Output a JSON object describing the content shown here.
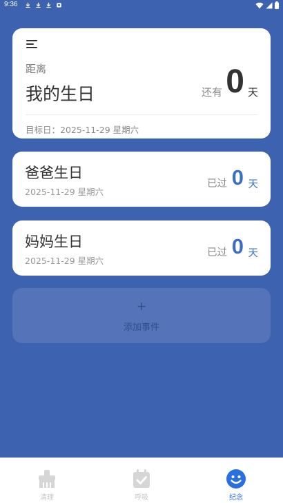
{
  "status_bar": {
    "time": "9:36"
  },
  "main_card": {
    "label": "距离",
    "title": "我的生日",
    "prefix": "还有",
    "days": "0",
    "unit": "天",
    "target_date": "目标日：2025-11-29 星期六"
  },
  "events": [
    {
      "title": "爸爸生日",
      "date": "2025-11-29 星期六",
      "prefix": "已过",
      "days": "0",
      "unit": "天"
    },
    {
      "title": "妈妈生日",
      "date": "2025-11-29 星期六",
      "prefix": "已过",
      "days": "0",
      "unit": "天"
    }
  ],
  "add_event": {
    "plus": "+",
    "label": "添加事件"
  },
  "nav": {
    "items": [
      {
        "label": "清理",
        "icon": "broom-icon"
      },
      {
        "label": "呼吸",
        "icon": "calendar-check-icon"
      },
      {
        "label": "纪念",
        "icon": "smiley-icon"
      }
    ],
    "active_index": 2
  },
  "colors": {
    "background": "#3d63b0",
    "accent": "#3a6fc4",
    "nav_active": "#2a6fe0",
    "nav_inactive": "#c8c8c8"
  }
}
